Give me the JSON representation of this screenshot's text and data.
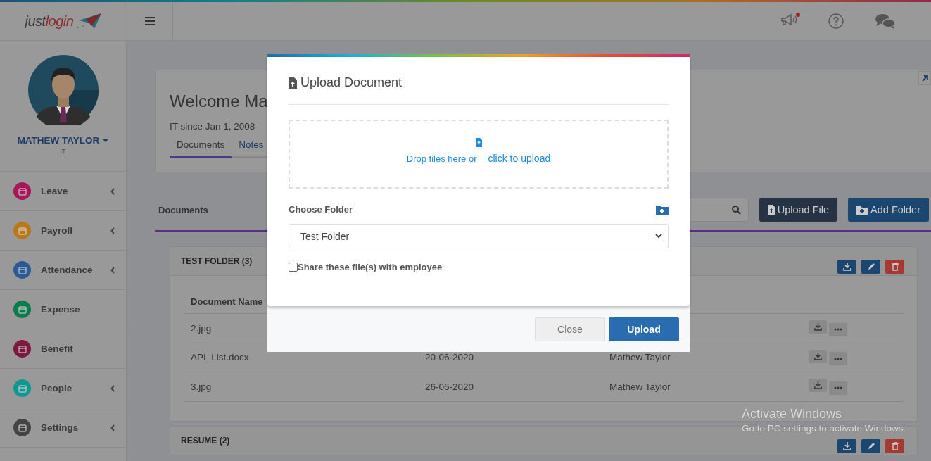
{
  "header": {
    "logo": "justlogin",
    "unread_notifications": true
  },
  "user": {
    "name": "MATHEW TAYLOR",
    "department": "IT"
  },
  "sidebar": {
    "items": [
      {
        "label": "Leave",
        "color": "#a5185a",
        "has_submenu": true
      },
      {
        "label": "Payroll",
        "color": "#b9781c",
        "has_submenu": true
      },
      {
        "label": "Attendance",
        "color": "#2d5a94",
        "has_submenu": true
      },
      {
        "label": "Expense",
        "color": "#0f7a4c",
        "has_submenu": false
      },
      {
        "label": "Benefit",
        "color": "#7a1a3e",
        "has_submenu": false
      },
      {
        "label": "People",
        "color": "#129690",
        "has_submenu": true
      },
      {
        "label": "Settings",
        "color": "#444444",
        "has_submenu": true
      }
    ]
  },
  "welcome": {
    "title": "Welcome Ma",
    "subtitle": "IT since Jan 1, 2008",
    "tabs": [
      {
        "label": "Documents",
        "selected": true
      },
      {
        "label": "Notes",
        "selected": false
      }
    ]
  },
  "documents": {
    "title": "Documents",
    "buttons": [
      {
        "label": "Upload File",
        "kind": "dark"
      },
      {
        "label": "Add Folder",
        "kind": "primary"
      }
    ]
  },
  "folders": [
    {
      "name": "TEST FOLDER (3)",
      "columns": [
        "Document Name"
      ],
      "rows": [
        {
          "cells": [
            "2.jpg"
          ]
        },
        {
          "cells": [
            "API_List.docx",
            "20-06-2020",
            "Mathew Taylor"
          ]
        },
        {
          "cells": [
            "3.jpg",
            "26-06-2020",
            "Mathew Taylor"
          ]
        }
      ]
    },
    {
      "name": "RESUME (2)"
    }
  ],
  "modal": {
    "title": "Upload Document",
    "drop_text": "Drop files here or",
    "drop_link": "click to upload",
    "folder_label": "Choose Folder",
    "folder_value": "Test Folder",
    "share_label": "Share these file(s) with employee",
    "share_checked": false,
    "buttons": [
      {
        "label": "Close",
        "kind": "secondary"
      },
      {
        "label": "Upload",
        "kind": "primary"
      }
    ]
  },
  "os_notice": {
    "title": "Activate Windows",
    "hint": "Go to PC settings to activate Windows."
  }
}
